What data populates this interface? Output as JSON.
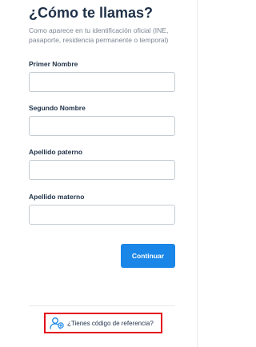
{
  "header": {
    "title": "¿Cómo te llamas?",
    "subtitle": "Como aparece en tu identificación oficial (INE, pasaporte, residencia permanente o temporal)"
  },
  "form": {
    "fields": [
      {
        "label": "Primer Nombre",
        "value": "",
        "placeholder": ""
      },
      {
        "label": "Segundo Nombre",
        "value": "",
        "placeholder": ""
      },
      {
        "label": "Apellido paterno",
        "value": "",
        "placeholder": ""
      },
      {
        "label": "Apellido materno",
        "value": "",
        "placeholder": ""
      }
    ],
    "submit_label": "Continuar"
  },
  "referral": {
    "text": "¿Tienes código de referencia?",
    "icon": "user-add-icon"
  },
  "colors": {
    "title": "#1f3148",
    "subtitle": "#7b8593",
    "primary_button": "#1a86e8",
    "highlight_border": "#e3101b",
    "icon": "#1a86e8"
  }
}
